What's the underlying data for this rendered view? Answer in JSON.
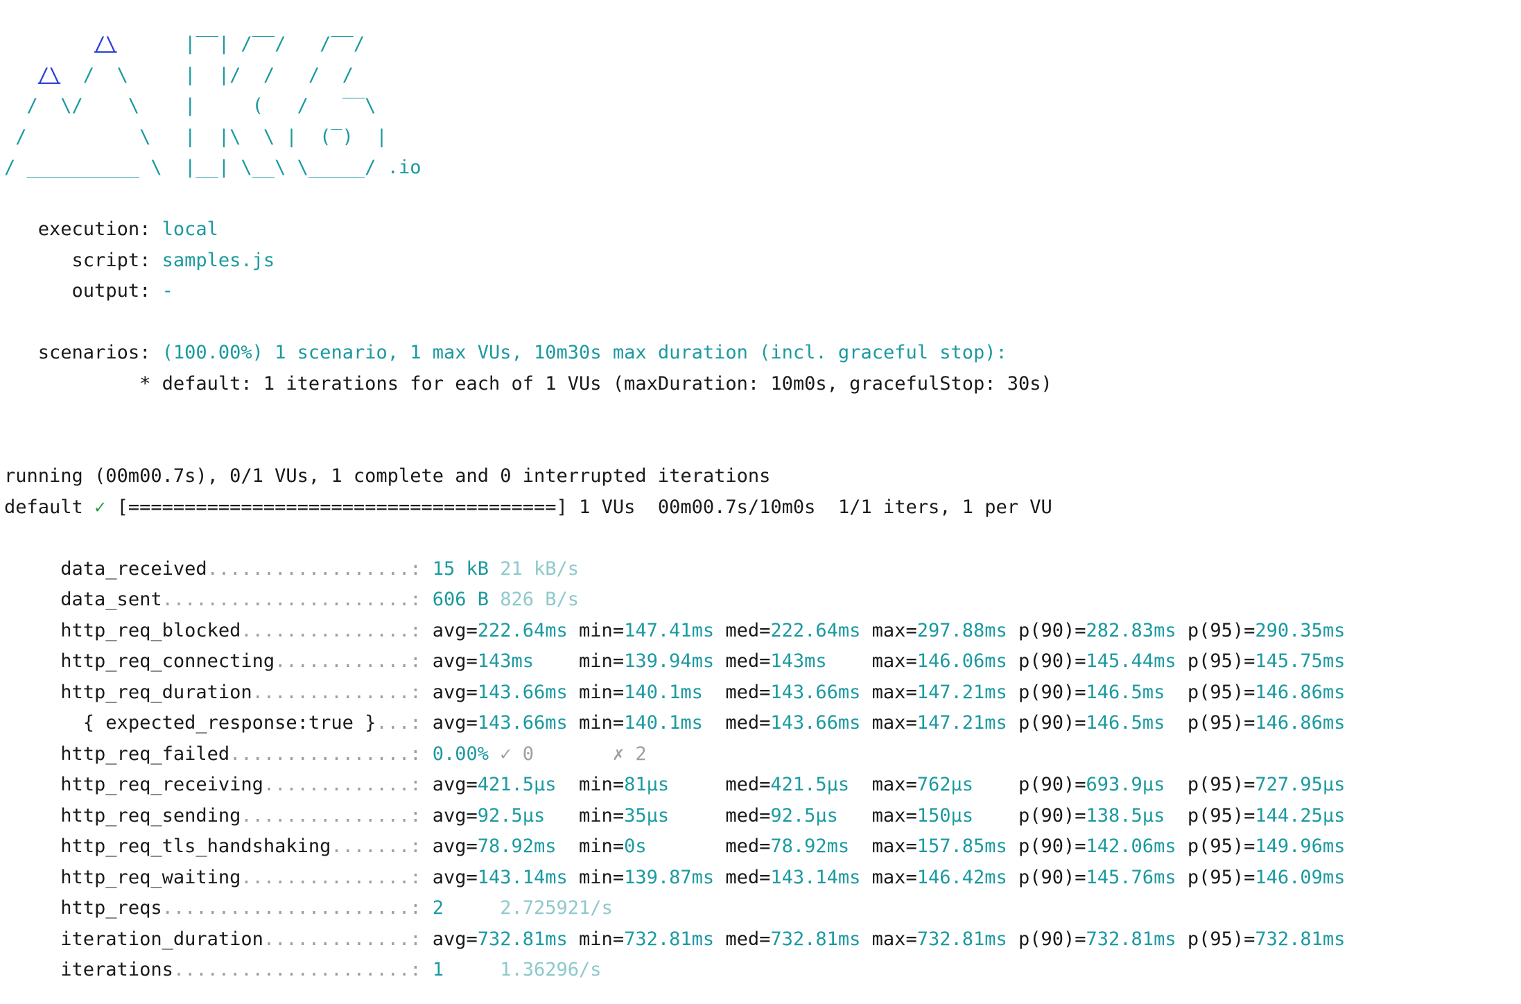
{
  "banner": {
    "lines": [
      "        /\\      |‾‾| /‾‾/   /‾‾/",
      "   /\\  /  \\     |  |/  /   /  /",
      "  /  \\/    \\    |     (   /   ‾‾\\",
      " /          \\   |  |\\  \\ |  (‾)  |",
      "/ __________ \\  |__| \\__\\ \\_____/ .io"
    ]
  },
  "execution": {
    "execution_label": "execution:",
    "execution_value": "local",
    "script_label": "script:",
    "script_value": "samples.js",
    "output_label": "output:",
    "output_value": "-"
  },
  "scenarios": {
    "label": "scenarios:",
    "summary": "(100.00%) 1 scenario, 1 max VUs, 10m30s max duration (incl. graceful stop):",
    "detail": "* default: 1 iterations for each of 1 VUs (maxDuration: 10m0s, gracefulStop: 30s)"
  },
  "progress": {
    "running": "running (00m00.7s), 0/1 VUs, 1 complete and 0 interrupted iterations",
    "scenario_name": "default",
    "check": "✓",
    "bar": "[======================================]",
    "stats": "1 VUs  00m00.7s/10m0s  1/1 iters, 1 per VU"
  },
  "metrics": [
    {
      "name": "data_received",
      "dots": "..................:",
      "values": [
        [
          "15 kB",
          "teal"
        ],
        [
          "21 kB/s",
          "pale"
        ]
      ]
    },
    {
      "name": "data_sent",
      "dots": "......................:",
      "values": [
        [
          "606 B",
          "teal"
        ],
        [
          "826 B/s",
          "pale"
        ]
      ]
    },
    {
      "name": "http_req_blocked",
      "dots": "...............:",
      "values": [
        [
          "avg=222.64ms",
          ""
        ],
        [
          "min=147.41ms",
          ""
        ],
        [
          "med=222.64ms",
          ""
        ],
        [
          "max=297.88ms",
          ""
        ],
        [
          "p(90)=282.83ms",
          ""
        ],
        [
          "p(95)=290.35ms",
          ""
        ]
      ]
    },
    {
      "name": "http_req_connecting",
      "dots": "............:",
      "values": [
        [
          "avg=143ms",
          ""
        ],
        [
          "min=139.94ms",
          ""
        ],
        [
          "med=143ms",
          ""
        ],
        [
          "max=146.06ms",
          ""
        ],
        [
          "p(90)=145.44ms",
          ""
        ],
        [
          "p(95)=145.75ms",
          ""
        ]
      ]
    },
    {
      "name": "http_req_duration",
      "dots": "..............:",
      "values": [
        [
          "avg=143.66ms",
          ""
        ],
        [
          "min=140.1ms",
          ""
        ],
        [
          "med=143.66ms",
          ""
        ],
        [
          "max=147.21ms",
          ""
        ],
        [
          "p(90)=146.5ms",
          ""
        ],
        [
          "p(95)=146.86ms",
          ""
        ]
      ]
    },
    {
      "name": "  { expected_response:true }",
      "dots": "...:",
      "values": [
        [
          "avg=143.66ms",
          ""
        ],
        [
          "min=140.1ms",
          ""
        ],
        [
          "med=143.66ms",
          ""
        ],
        [
          "max=147.21ms",
          ""
        ],
        [
          "p(90)=146.5ms",
          ""
        ],
        [
          "p(95)=146.86ms",
          ""
        ]
      ]
    },
    {
      "name": "http_req_failed",
      "dots": "................:",
      "values": [
        [
          "0.00%",
          "teal"
        ],
        [
          "✓ 0",
          "grey"
        ],
        [
          "✗ 2",
          "grey"
        ]
      ]
    },
    {
      "name": "http_req_receiving",
      "dots": ".............:",
      "values": [
        [
          "avg=421.5µs",
          ""
        ],
        [
          "min=81µs",
          ""
        ],
        [
          "med=421.5µs",
          ""
        ],
        [
          "max=762µs",
          ""
        ],
        [
          "p(90)=693.9µs",
          ""
        ],
        [
          "p(95)=727.95µs",
          ""
        ]
      ]
    },
    {
      "name": "http_req_sending",
      "dots": "...............:",
      "values": [
        [
          "avg=92.5µs",
          ""
        ],
        [
          "min=35µs",
          ""
        ],
        [
          "med=92.5µs",
          ""
        ],
        [
          "max=150µs",
          ""
        ],
        [
          "p(90)=138.5µs",
          ""
        ],
        [
          "p(95)=144.25µs",
          ""
        ]
      ]
    },
    {
      "name": "http_req_tls_handshaking",
      "dots": ".......:",
      "values": [
        [
          "avg=78.92ms",
          ""
        ],
        [
          "min=0s",
          ""
        ],
        [
          "med=78.92ms",
          ""
        ],
        [
          "max=157.85ms",
          ""
        ],
        [
          "p(90)=142.06ms",
          ""
        ],
        [
          "p(95)=149.96ms",
          ""
        ]
      ]
    },
    {
      "name": "http_req_waiting",
      "dots": "...............:",
      "values": [
        [
          "avg=143.14ms",
          ""
        ],
        [
          "min=139.87ms",
          ""
        ],
        [
          "med=143.14ms",
          ""
        ],
        [
          "max=146.42ms",
          ""
        ],
        [
          "p(90)=145.76ms",
          ""
        ],
        [
          "p(95)=146.09ms",
          ""
        ]
      ]
    },
    {
      "name": "http_reqs",
      "dots": "......................:",
      "values": [
        [
          "2",
          "teal"
        ],
        [
          "2.725921/s",
          "pale"
        ]
      ]
    },
    {
      "name": "iteration_duration",
      "dots": ".............:",
      "values": [
        [
          "avg=732.81ms",
          ""
        ],
        [
          "min=732.81ms",
          ""
        ],
        [
          "med=732.81ms",
          ""
        ],
        [
          "max=732.81ms",
          ""
        ],
        [
          "p(90)=732.81ms",
          ""
        ],
        [
          "p(95)=732.81ms",
          ""
        ]
      ]
    },
    {
      "name": "iterations",
      "dots": ".....................:",
      "values": [
        [
          "1",
          "teal"
        ],
        [
          "1.36296/s",
          "pale"
        ]
      ]
    }
  ]
}
